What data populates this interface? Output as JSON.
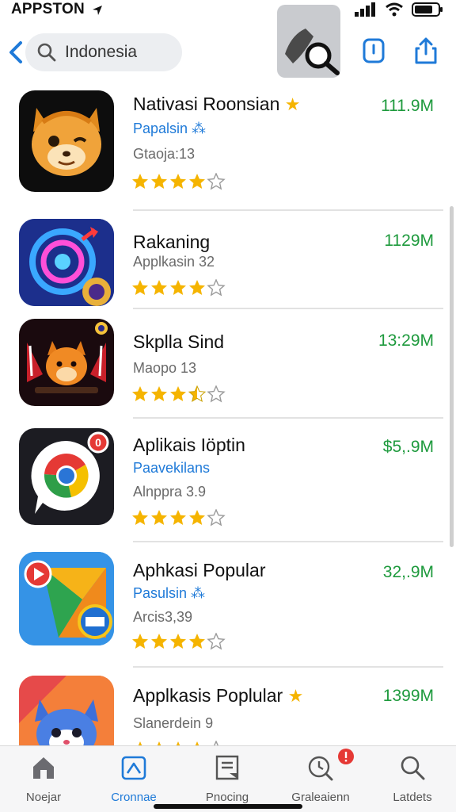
{
  "status": {
    "time": "APPSTON"
  },
  "search": {
    "value": "Indonesia"
  },
  "apps": [
    {
      "title": "Nativasi Roonsian",
      "sub_blue": "Papalsin ⁂",
      "sub_grey": "Gtaoja:13",
      "rating": 4,
      "size": "111.9M"
    },
    {
      "title": "Rakaning",
      "sub_blue": "",
      "sub_grey": "Applkasin 32",
      "rating": 4,
      "size": "1129M"
    },
    {
      "title": "Skplla Sind",
      "sub_blue": "",
      "sub_grey": "Maopo 13",
      "rating": 3.5,
      "size": "13:29M"
    },
    {
      "title": "Aplikais Iöptin",
      "sub_blue": "Paavekilans",
      "sub_grey": "Alnppra 3.9",
      "rating": 4,
      "size": "$5,.9M"
    },
    {
      "title": "Aphkasi Popular",
      "sub_blue": "Pasulsin ⁂",
      "sub_grey": "Arcis3,39",
      "rating": 4,
      "size": "32,.9M"
    },
    {
      "title": "Applkasis Poplular",
      "sub_blue": "",
      "sub_grey": "Slanerdein 9",
      "rating": 4,
      "size": "1399M"
    }
  ],
  "tabs": [
    {
      "label": "Noejar",
      "icon": "home-icon"
    },
    {
      "label": "Cronnae",
      "icon": "today-icon"
    },
    {
      "label": "Pnocing",
      "icon": "document-icon"
    },
    {
      "label": "Graleaienn",
      "icon": "clock-search-icon"
    },
    {
      "label": "Latdets",
      "icon": "search-icon"
    }
  ],
  "colors": {
    "accent": "#1f7ad8",
    "size_green": "#1e9a3d",
    "star": "#f5b400",
    "badge": "#e53935"
  }
}
